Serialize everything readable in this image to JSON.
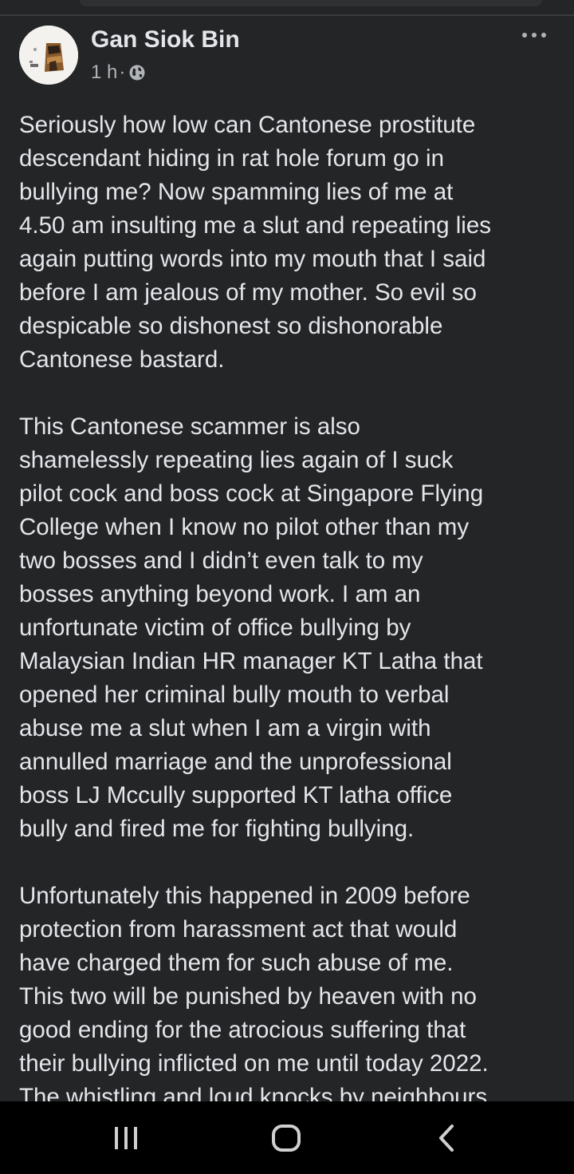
{
  "post": {
    "author": "Gan Siok Bin",
    "time": "1 h",
    "separator": "·",
    "paragraphs": [
      "Seriously how low can Cantonese prostitute\ndescendant hiding in rat hole forum go in\nbullying me? Now spamming lies of me at\n4.50 am insulting me a slut and repeating lies\nagain putting words into my mouth that I said\nbefore I am jealous of my mother. So evil so\ndespicable so dishonest so dishonorable\nCantonese bastard.",
      "This Cantonese scammer is also\nshamelessly repeating lies again of I suck\npilot cock and boss cock at Singapore Flying\nCollege when I know no pilot other than my\ntwo bosses and I didn’t even talk to my\nbosses anything beyond work. I am an\nunfortunate victim of office bullying by\nMalaysian Indian HR manager KT Latha that\nopened her criminal bully mouth to verbal\nabuse me a slut when I am a virgin with\nannulled marriage and the unprofessional\nboss LJ Mccully supported KT latha office\nbully and fired me for fighting bullying.",
      "Unfortunately this happened in 2009 before\nprotection from harassment act that would\nhave charged them for such abuse of me.\nThis two will be punished by heaven with no\ngood ending for the atrocious suffering that\ntheir bullying inflicted on me until today 2022.\nThe whistling and loud knocks by neighbours"
    ]
  },
  "icons": {
    "audience": "globe-icon",
    "more": "more-options-icon",
    "nav_recent": "recent-apps-icon",
    "nav_home": "home-icon",
    "nav_back": "back-icon"
  },
  "colors": {
    "background": "#242526",
    "primary_text": "#e4e6eb",
    "secondary_text": "#b0b3b8",
    "nav_bar": "#000000"
  }
}
